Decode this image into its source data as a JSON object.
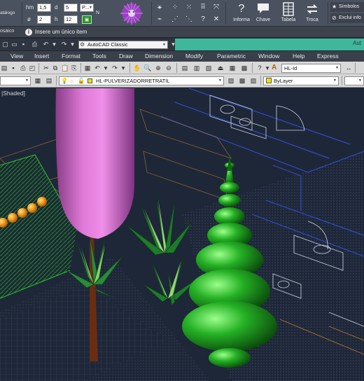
{
  "ribbon": {
    "left_labels": [
      "atálogo",
      "osaico"
    ],
    "fields": {
      "hm_label": "hm",
      "hm_value": "1,5",
      "d_label": "d",
      "d_value": "5",
      "p_value": "P...",
      "diam_label": "ø",
      "diam_value": "2",
      "h_label": "h",
      "h_value": "12",
      "n_label": "N"
    },
    "buttons": [
      {
        "label": "Informa",
        "icon": "question-icon"
      },
      {
        "label": "Chave",
        "icon": "speech-bubble-icon"
      },
      {
        "label": "Tabela",
        "icon": "table-icon"
      },
      {
        "label": "Troca",
        "icon": "swap-icon"
      }
    ],
    "side_items": [
      "Símbolos",
      "Exclui info"
    ],
    "status_text": "Insere um único item"
  },
  "quick_access": {
    "workspace": "AutoCAD Classic",
    "app_title": "Aut"
  },
  "menu": [
    "View",
    "Insert",
    "Format",
    "Tools",
    "Draw",
    "Dimension",
    "Modify",
    "Parametric",
    "Window",
    "Help",
    "Express"
  ],
  "toolbar": {
    "text_style": "HL-Id"
  },
  "layers": {
    "current_layer": "HL-PULVERIZADORRETRATIL",
    "color": "ByLayer"
  },
  "viewport": {
    "visual_style": "|Shaded]"
  },
  "colors": {
    "ribbon_bg": "#4a5260",
    "title_accent": "#3fb79a",
    "viewport_bg": "#1e2738",
    "hedge_green": "#1bb51b",
    "magenta_tree": "#d96ad0",
    "orange_spheres": "#f39a1a"
  }
}
